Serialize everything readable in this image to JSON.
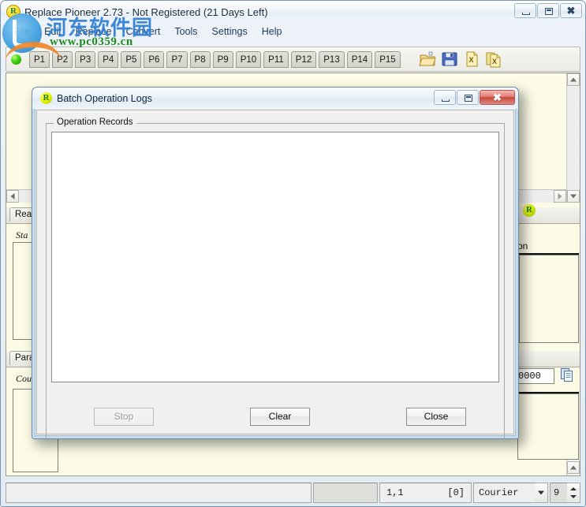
{
  "app": {
    "title": "Replace Pioneer 2.73 - Not Registered (21 Days Left)",
    "icon": "R",
    "window_controls": {
      "minimize": "minimize-icon",
      "maximize": "maximize-icon",
      "close": "close-icon"
    }
  },
  "menu": {
    "items": [
      {
        "label": "File"
      },
      {
        "label": "Edit"
      },
      {
        "label": "Replace"
      },
      {
        "label": "Convert"
      },
      {
        "label": "Tools"
      },
      {
        "label": "Settings"
      },
      {
        "label": "Help"
      }
    ]
  },
  "watermark": {
    "chinese": "河东软件园",
    "url": "www.pc0359.cn"
  },
  "toolbar": {
    "status_indicator": "green-dot-icon",
    "preset_tabs": [
      "P1",
      "P2",
      "P3",
      "P4",
      "P5",
      "P6",
      "P7",
      "P8",
      "P9",
      "P10",
      "P11",
      "P12",
      "P13",
      "P14",
      "P15"
    ],
    "icons": [
      {
        "name": "folder-open-icon"
      },
      {
        "name": "save-icon"
      },
      {
        "name": "export-excel-icon"
      },
      {
        "name": "export-excel-multi-icon"
      }
    ]
  },
  "background_panes": {
    "left_tab": "Real",
    "left_sublabel": "Sta",
    "left_tab_2": "Para",
    "left_sublabel_2": "Cou",
    "right_label": "on",
    "right_icon": "R",
    "numeric_value": "0000",
    "copy_icon": "copy-icon"
  },
  "dialog": {
    "title": "Batch Operation Logs",
    "icon": "R",
    "groupbox_legend": "Operation Records",
    "records": [],
    "window_controls": {
      "minimize": "minimize-icon",
      "maximize": "maximize-icon",
      "close": "close-icon"
    },
    "buttons": {
      "stop": "Stop",
      "clear": "Clear",
      "close": "Close"
    }
  },
  "status_bar": {
    "message": "",
    "cursor_position": "1,1",
    "selection_count": "[0]",
    "font_name": "Courier",
    "font_size": "9"
  },
  "colors": {
    "accent": "#3b9ee0",
    "close_red": "#c6483c",
    "document_bg": "#fbfbe6",
    "status_green": "#3dd20f",
    "watermark_green": "#1f8a1f"
  }
}
